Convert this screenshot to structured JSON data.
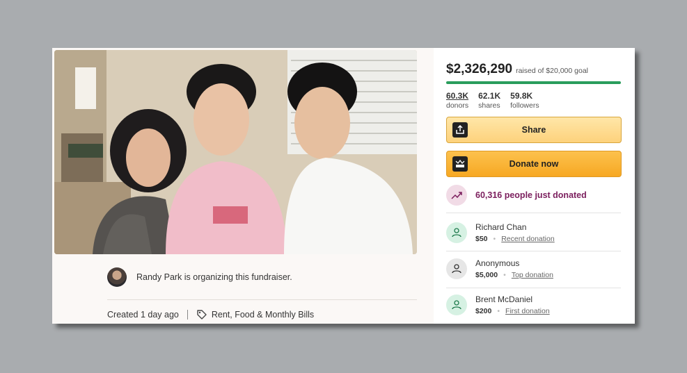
{
  "campaign": {
    "organizer_text": "Randy Park is organizing this fundraiser.",
    "created": "Created 1 day ago",
    "category": "Rent, Food & Monthly Bills",
    "photo_icon": "family-photo"
  },
  "sidebar": {
    "amount": "$2,326,290",
    "goal": "raised of $20,000 goal",
    "progress_fraction": 1.0,
    "progress_color": "#2a9d5c",
    "stats": [
      {
        "value": "60.3K",
        "label": "donors"
      },
      {
        "value": "62.1K",
        "label": "shares"
      },
      {
        "value": "59.8K",
        "label": "followers"
      }
    ],
    "share_label": "Share",
    "donate_label": "Donate now",
    "recent_count_text": "60,316 people just donated",
    "donations": [
      {
        "name": "Richard Chan",
        "amount": "$50",
        "type": "Recent donation",
        "icon_color": "#d6f1e3"
      },
      {
        "name": "Anonymous",
        "amount": "$5,000",
        "type": "Top donation",
        "icon_color": "#e6e6e6"
      },
      {
        "name": "Brent McDaniel",
        "amount": "$200",
        "type": "First donation",
        "icon_color": "#d6f1e3"
      }
    ]
  }
}
